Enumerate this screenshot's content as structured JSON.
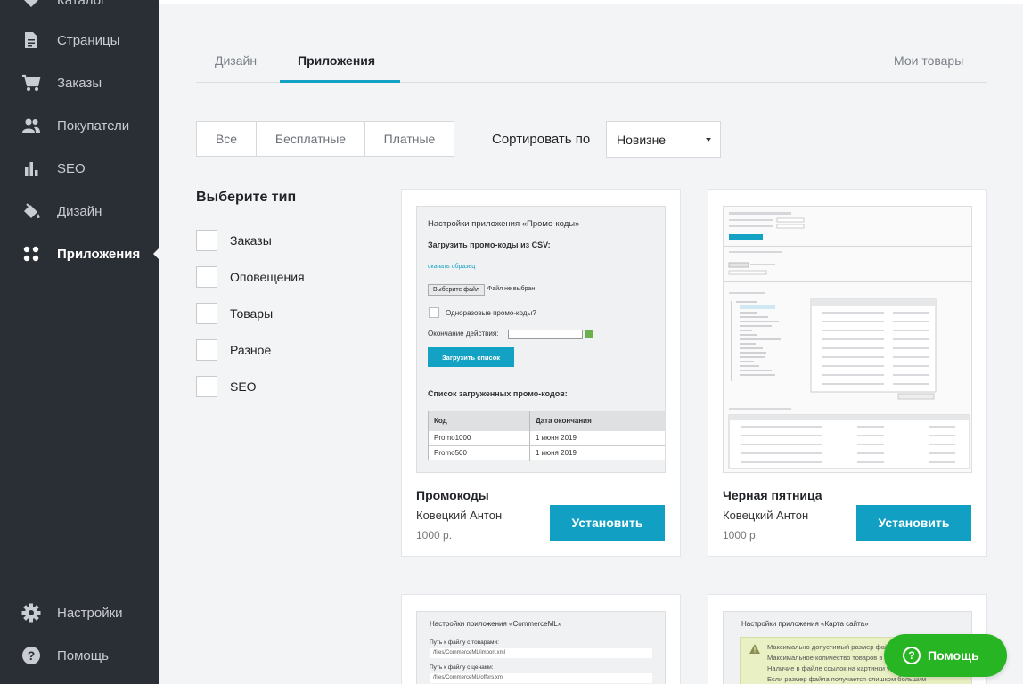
{
  "sidebar": {
    "items": [
      {
        "label": "Каталог",
        "icon": "tag-icon"
      },
      {
        "label": "Страницы",
        "icon": "document-icon"
      },
      {
        "label": "Заказы",
        "icon": "cart-icon"
      },
      {
        "label": "Покупатели",
        "icon": "users-icon"
      },
      {
        "label": "SEO",
        "icon": "bar-chart-icon"
      },
      {
        "label": "Дизайн",
        "icon": "paint-bucket-icon"
      },
      {
        "label": "Приложения",
        "icon": "apps-grid-icon",
        "active": true
      }
    ],
    "bottom": [
      {
        "label": "Настройки",
        "icon": "gear-icon"
      },
      {
        "label": "Помощь",
        "icon": "question-icon"
      }
    ]
  },
  "tabs": {
    "design": "Дизайн",
    "apps": "Приложения",
    "my_products": "Мои товары"
  },
  "filters": {
    "all": "Все",
    "free": "Бесплатные",
    "paid": "Платные"
  },
  "sort": {
    "label": "Сортировать по",
    "value": "Новизне"
  },
  "types": {
    "title": "Выберите тип",
    "items": [
      "Заказы",
      "Оповещения",
      "Товары",
      "Разное",
      "SEO"
    ]
  },
  "install_label": "Установить",
  "cards": [
    {
      "title": "Промокоды",
      "author": "Ковецкий Антон",
      "price": "1000 р.",
      "preview": {
        "heading": "Настройки приложения «Промо-коды»",
        "upload_title": "Загрузить промо-коды из CSV:",
        "download_link": "скачать образец",
        "file_button": "Выберите файл",
        "file_status": "Файл не выбран",
        "checkbox_label": "Одноразовые промо-коды?",
        "end_label": "Окончание действия:",
        "upload_button": "Загрузить список",
        "list_title": "Список загруженных промо-кодов:",
        "table_headers": [
          "Код",
          "Дата окончания"
        ],
        "table_rows": [
          [
            "Promo1000",
            "1 июня 2019"
          ],
          [
            "Promo500",
            "1 июня 2019"
          ]
        ]
      }
    },
    {
      "title": "Черная пятница",
      "author": "Ковецкий Антон",
      "price": "1000 р."
    },
    {
      "preview": {
        "heading": "Настройки приложения «CommerceML»",
        "label1": "Путь к файлу с товарами:",
        "value1": "/files/CommerceML/import.xml",
        "label2": "Путь к файлу с ценами:",
        "value2": "/files/CommerceML/offers.xml"
      }
    },
    {
      "preview": {
        "heading": "Настройки приложения «Карта сайта»",
        "warnings": [
          "Максимально допустимый размер файла",
          "Максимальное количество товаров в од",
          "Наличие в файле ссылок на картинки у",
          "Если размер файла получается слишком большим"
        ]
      }
    }
  ],
  "help": {
    "label": "Помощь"
  },
  "colors": {
    "sidebar_bg": "#2a2e35",
    "accent": "#11a0c3",
    "help_green": "#27b523"
  }
}
